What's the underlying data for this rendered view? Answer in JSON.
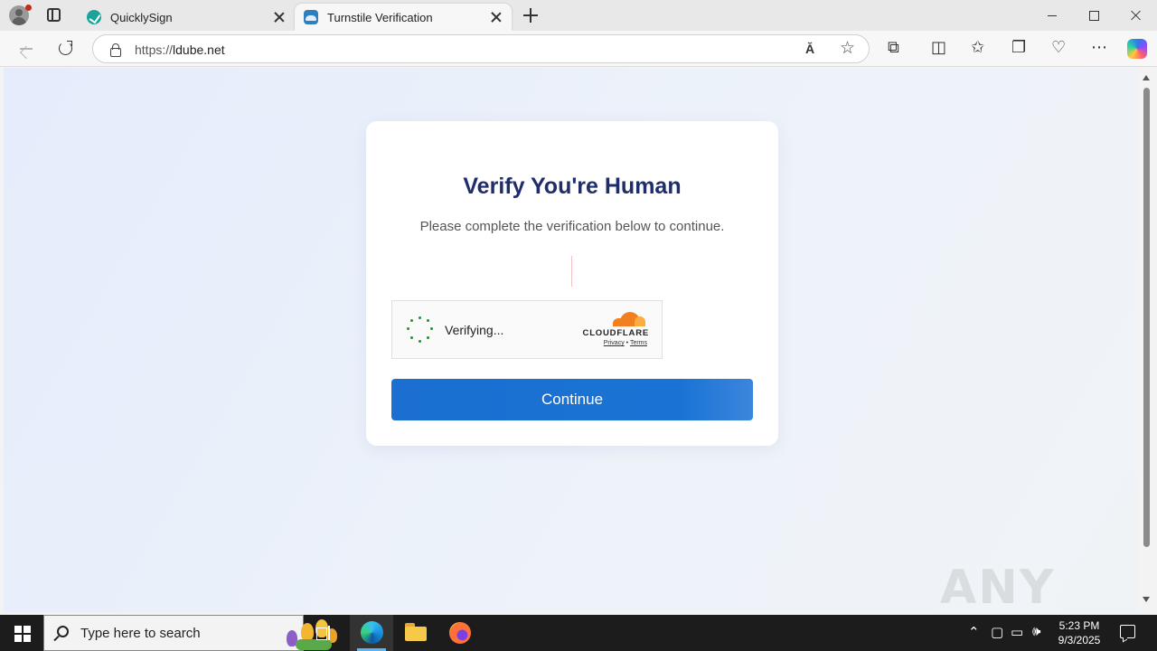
{
  "browser": {
    "tabs": [
      {
        "label": "QuicklySign",
        "active": false
      },
      {
        "label": "Turnstile Verification",
        "active": true
      }
    ],
    "address": {
      "protocol": "https://",
      "host": "ldube.net"
    },
    "read_aloud_label": "Ă"
  },
  "page": {
    "heading": "Verify You're Human",
    "subtitle": "Please complete the verification below to continue.",
    "widget": {
      "status": "Verifying...",
      "brand": "CLOUDFLARE",
      "privacy_link": "Privacy",
      "separator": "•",
      "terms_link": "Terms"
    },
    "continue_label": "Continue",
    "watermark": "ANY RUN"
  },
  "taskbar": {
    "search_placeholder": "Type here to search",
    "time": "5:23 PM",
    "date": "9/3/2025"
  },
  "colors": {
    "heading": "#1f2d6b",
    "button": "#1a6fd0",
    "cloudflare_orange": "#f38020",
    "spinner": "#2f8a3a"
  }
}
